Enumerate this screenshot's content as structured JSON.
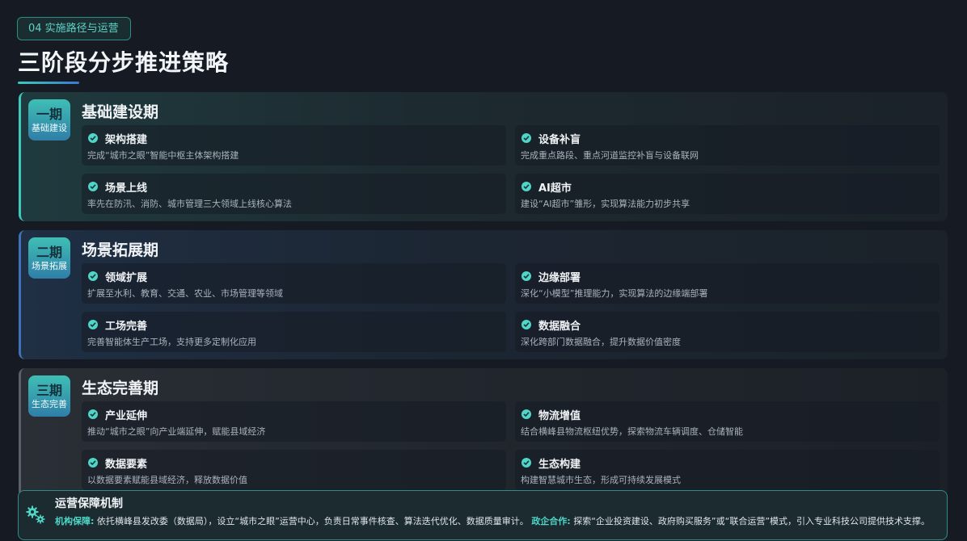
{
  "section_tag": "04 实施路径与运营",
  "page_title": "三阶段分步推进策略",
  "phases": [
    {
      "badge_main": "一期",
      "badge_sub": "基础建设",
      "title": "基础建设期",
      "items": [
        {
          "title": "架构搭建",
          "desc": "完成“城市之眼”智能中枢主体架构搭建"
        },
        {
          "title": "设备补盲",
          "desc": "完成重点路段、重点河道监控补盲与设备联网"
        },
        {
          "title": "场景上线",
          "desc": "率先在防汛、消防、城市管理三大领域上线核心算法"
        },
        {
          "title": "AI超市",
          "desc": "建设“AI超市”雏形，实现算法能力初步共享"
        }
      ]
    },
    {
      "badge_main": "二期",
      "badge_sub": "场景拓展",
      "title": "场景拓展期",
      "items": [
        {
          "title": "领域扩展",
          "desc": "扩展至水利、教育、交通、农业、市场管理等领域"
        },
        {
          "title": "边缘部署",
          "desc": "深化“小模型”推理能力，实现算法的边缘端部署"
        },
        {
          "title": "工场完善",
          "desc": "完善智能体生产工场，支持更多定制化应用"
        },
        {
          "title": "数据融合",
          "desc": "深化跨部门数据融合，提升数据价值密度"
        }
      ]
    },
    {
      "badge_main": "三期",
      "badge_sub": "生态完善",
      "title": "生态完善期",
      "items": [
        {
          "title": "产业延伸",
          "desc": "推动“城市之眼”向产业端延伸，赋能县域经济"
        },
        {
          "title": "物流增值",
          "desc": "结合横峰县物流枢纽优势，探索物流车辆调度、仓储智能"
        },
        {
          "title": "数据要素",
          "desc": "以数据要素赋能县域经济，释放数据价值"
        },
        {
          "title": "生态构建",
          "desc": "构建智慧城市生态，形成可持续发展模式"
        }
      ]
    }
  ],
  "ops": {
    "icon": "gears-icon",
    "title": "运营保障机制",
    "label1": "机构保障:",
    "text1": "依托横峰县发改委（数据局），设立“城市之眼”运营中心，负责日常事件核查、算法迭代优化、数据质量审计。",
    "label2": "政企合作:",
    "text2": "探索“企业投资建设、政府购买服务”或“联合运营”模式，引入专业科技公司提供技术支撑。"
  },
  "colors": {
    "accent": "#4fd6c6",
    "phase1_border": "#3cc8bb",
    "phase2_border": "#3f72b8",
    "phase3_border": "#5a6068",
    "background": "#161a22"
  }
}
